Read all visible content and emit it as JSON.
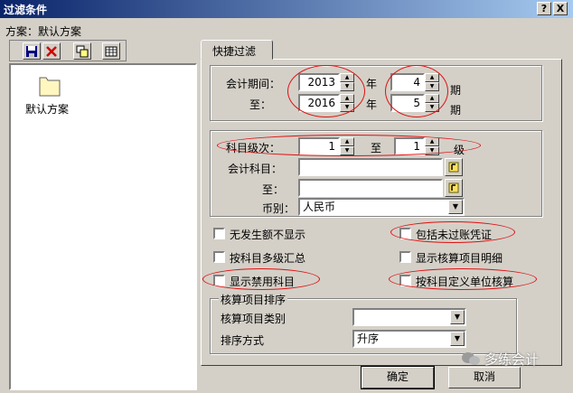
{
  "window": {
    "title": "过滤条件",
    "help_label": "?",
    "close_label": "X"
  },
  "scheme": {
    "label": "方案：默认方案",
    "toolbar": [
      "save-icon",
      "delete-icon",
      "copy-icon",
      "grid-icon"
    ],
    "items": [
      {
        "label": "默认方案",
        "icon": "folder-icon"
      }
    ]
  },
  "tab": {
    "label": "快捷过滤"
  },
  "period": {
    "from_label": "会计期间：",
    "to_label": "至：",
    "year_unit": "年",
    "period_unit": "期",
    "from_year": "2013",
    "to_year": "2016",
    "from_period": "4",
    "to_period": "5"
  },
  "subject": {
    "level_label": "科目级次：",
    "level_from": "1",
    "level_to_label": "至",
    "level_to": "1",
    "level_unit": "级",
    "account_label": "会计科目：",
    "account_to_label": "至：",
    "currency_label": "币别：",
    "currency_value": "人民币"
  },
  "options": [
    {
      "label": "无发生额不显示",
      "checked": false
    },
    {
      "label": "包括未过账凭证",
      "checked": false
    },
    {
      "label": "按科目多级汇总",
      "checked": false
    },
    {
      "label": "显示核算项目明细",
      "checked": false
    },
    {
      "label": "显示禁用科目",
      "checked": false
    },
    {
      "label": "按科目定义单位核算",
      "checked": false
    }
  ],
  "sorting": {
    "group_label": "核算项目排序",
    "category_label": "核算项目类别",
    "category_value": "",
    "order_label": "排序方式",
    "order_value": "升序"
  },
  "buttons": {
    "ok": "确定",
    "cancel": "取消"
  },
  "watermark": "多练会计",
  "colors": {
    "titlebar": "#0a246a",
    "annotation": "#e01010",
    "face": "#d4d0c8"
  }
}
